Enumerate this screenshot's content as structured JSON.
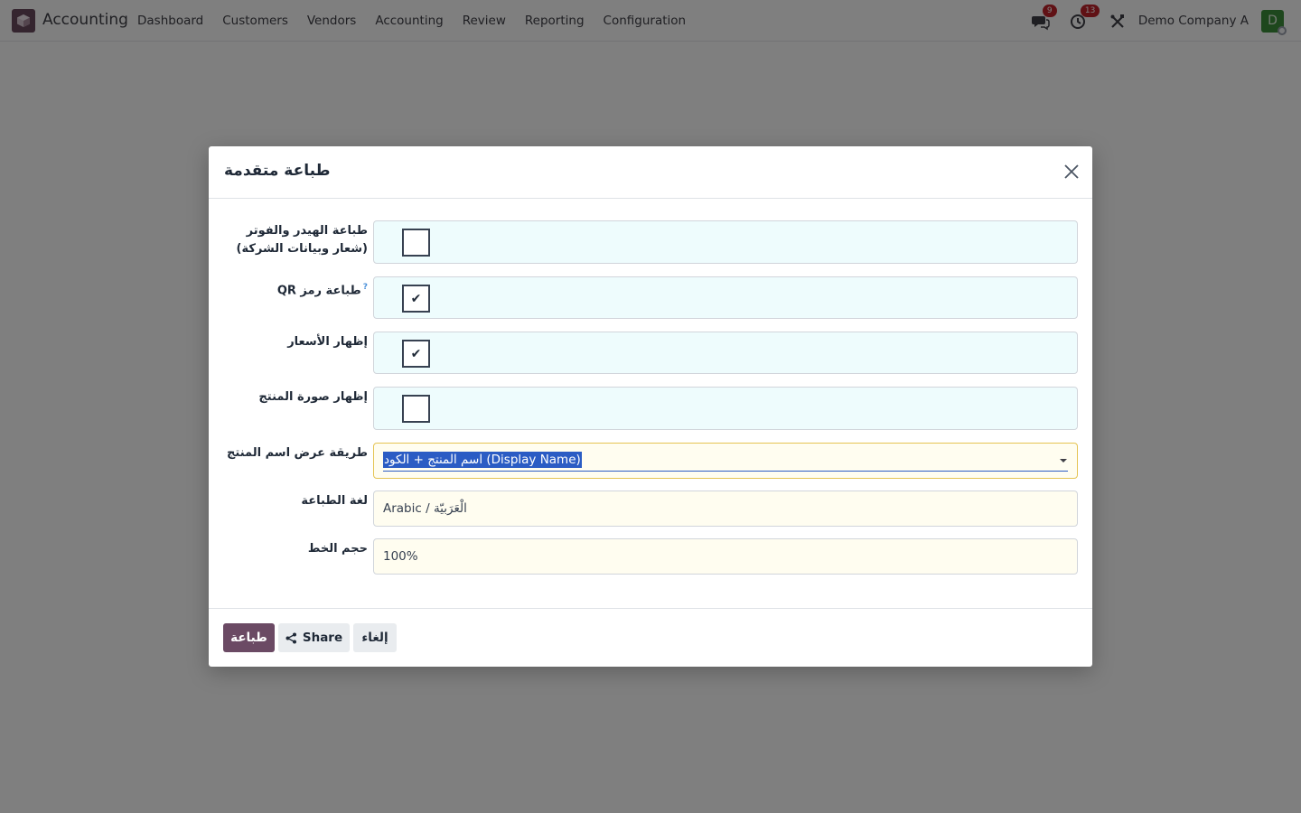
{
  "navbar": {
    "app_name": "Accounting",
    "menu": [
      "Dashboard",
      "Customers",
      "Vendors",
      "Accounting",
      "Review",
      "Reporting",
      "Configuration"
    ],
    "messages_badge": "9",
    "activities_badge": "13",
    "company": "Demo Company A",
    "avatar_letter": "D"
  },
  "modal": {
    "title": "طباعة متقدمة",
    "fields": {
      "header_footer": {
        "label_line1": "طباعة الهيدر والفوتر",
        "label_line2": "(شعار وبيانات الشركة)",
        "checked": false
      },
      "qr_code": {
        "label": "طباعة رمز QR",
        "help": "?",
        "checked": true
      },
      "show_prices": {
        "label": "إظهار الأسعار",
        "checked": true
      },
      "show_image": {
        "label": "إظهار صورة المنتج",
        "checked": false
      },
      "name_display": {
        "label": "طريقة عرض اسم المنتج",
        "value": "اسم المنتج + الكود (Display Name)"
      },
      "language": {
        "label": "لغة الطباعة",
        "value": "Arabic / الْعَرَبيّة"
      },
      "font_size": {
        "label": "حجم الخط",
        "value": "100%"
      }
    },
    "buttons": {
      "print": "طباعة",
      "share": "Share",
      "cancel": "إلغاء"
    },
    "check_mark": "✔"
  },
  "colors": {
    "primary": "#6b4a64",
    "checkbox_bg": "#eefcfd",
    "input_bg": "#fffdf0",
    "selection": "#2b5cc4"
  }
}
